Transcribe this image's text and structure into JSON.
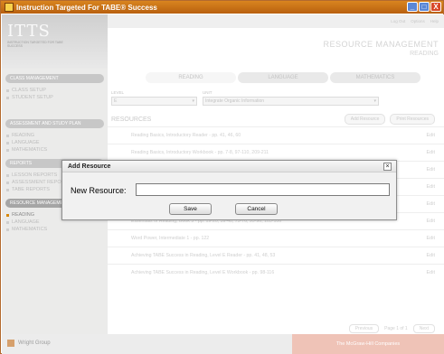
{
  "window": {
    "title": "Instruction Targeted For TABE® Success",
    "buttons": [
      "_",
      "□",
      "X"
    ]
  },
  "sidebar": {
    "logo_big": "ITTS",
    "logo_small": "INSTRUCTION TARGETED FOR TABE SUCCESS",
    "sections": [
      {
        "title": "Class Management",
        "items": [
          "Class Setup",
          "Student Setup"
        ],
        "active": null
      },
      {
        "title": "Assessment and Study Plan",
        "items": [
          "Reading",
          "Language",
          "Mathematics"
        ],
        "active": null
      },
      {
        "title": "Reports",
        "items": [
          "Lesson Reports",
          "Assessment Reports",
          "TABE Reports"
        ],
        "active": null
      },
      {
        "title": "Resource Management",
        "items": [
          "Reading",
          "Language",
          "Mathematics"
        ],
        "active": 0
      }
    ]
  },
  "topbar": {
    "links": [
      "Log Out",
      "Options",
      "Help"
    ]
  },
  "header": {
    "title": "Resource Management",
    "subtitle": "Reading"
  },
  "tabs": [
    {
      "label": "Reading",
      "active": true
    },
    {
      "label": "Language",
      "active": false
    },
    {
      "label": "Mathematics",
      "active": false
    }
  ],
  "filters": {
    "level_label": "Level",
    "level_value": "E",
    "unit_label": "Unit",
    "unit_value": "Integrate Organic Information"
  },
  "resources": {
    "title": "Resources",
    "add_button": "Add Resource",
    "print_button": "Print Resources",
    "edit_label": "Edit",
    "rows": [
      "Reading Basics, Introductory Reader - pp. 41, 46, 60",
      "Reading Basics, Introductory Workbook - pp. 7-8, 97-110, 209-211",
      "",
      "",
      "",
      "Essentials of Reading, Book 3 - pp. 19-20, 39-40, 75-76, 95-96, 103-106",
      "Word Power, Intermediate 1 - pp. 122",
      "Achieving TABE Success in Reading, Level E Reader - pp. 41, 48, 53",
      "Achieving TABE Success in Reading, Level E Workbook - pp. 98-116"
    ]
  },
  "pager": {
    "prev": "Previous",
    "page": "Page 1 of 1",
    "next": "Next"
  },
  "footer": {
    "left": "Wright Group",
    "right": "The McGraw-Hill Companies"
  },
  "dialog": {
    "title": "Add Resource",
    "close": "×",
    "label": "New Resource:",
    "input_value": "",
    "save": "Save",
    "cancel": "Cancel"
  }
}
